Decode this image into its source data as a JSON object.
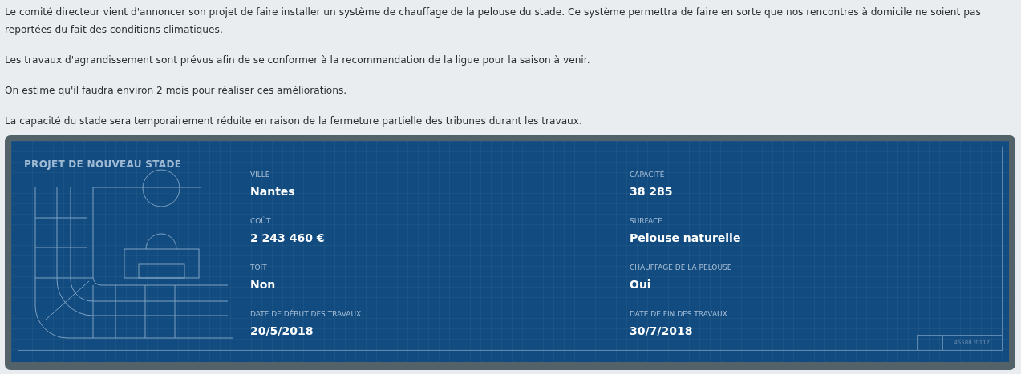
{
  "paragraphs": [
    "Le comité directeur vient d'annoncer son projet de faire installer un système de chauffage de la pelouse du stade. Ce système permettra de faire en sorte que nos rencontres à domicile ne soient pas reportées du fait des conditions climatiques.",
    "Les travaux d'agrandissement sont prévus afin de se conformer à la recommandation de la ligue pour la saison à venir.",
    "On estime qu'il faudra environ 2 mois pour réaliser ces améliorations.",
    "La capacité du stade sera temporairement réduite en raison de la fermeture partielle des tribunes durant les travaux."
  ],
  "panel": {
    "title": "PROJET DE NOUVEAU STADE",
    "fields": [
      {
        "label": "VILLE",
        "value": "Nantes"
      },
      {
        "label": "CAPACITÉ",
        "value": "38 285"
      },
      {
        "label": "COÛT",
        "value": "2 243 460 €"
      },
      {
        "label": "SURFACE",
        "value": "Pelouse naturelle"
      },
      {
        "label": "TOIT",
        "value": "Non"
      },
      {
        "label": "CHAUFFAGE DE LA PELOUSE",
        "value": "Oui"
      },
      {
        "label": "DATE DE DÉBUT DES TRAVAUX",
        "value": "20/5/2018"
      },
      {
        "label": "DATE DE FIN DES TRAVAUX",
        "value": "30/7/2018"
      }
    ],
    "stamp": "45588 /0112"
  }
}
